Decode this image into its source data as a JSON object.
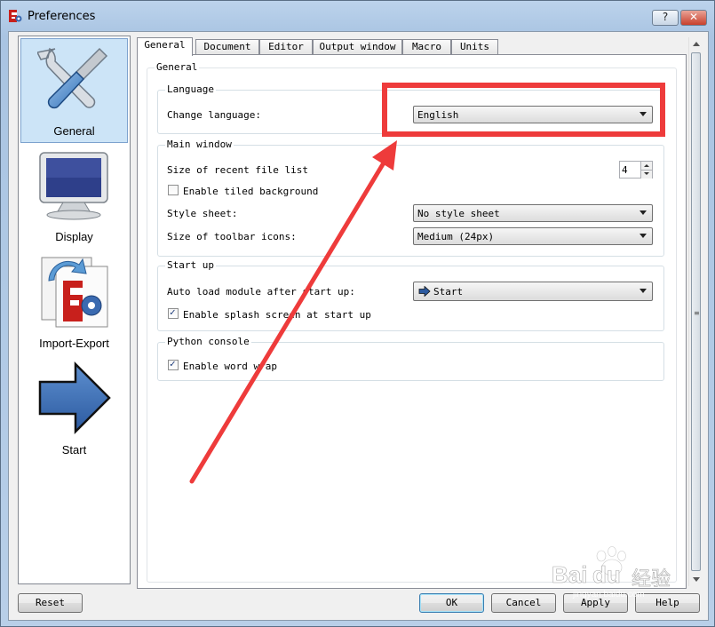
{
  "window": {
    "title": "Preferences",
    "help_button": "?",
    "close_button": "✕"
  },
  "sidebar": {
    "items": [
      {
        "label": "General",
        "icon": "wrench-screwdriver-icon",
        "selected": true
      },
      {
        "label": "Display",
        "icon": "monitor-icon",
        "selected": false
      },
      {
        "label": "Import-Export",
        "icon": "import-export-icon",
        "selected": false
      },
      {
        "label": "Start",
        "icon": "arrow-right-icon",
        "selected": false
      }
    ]
  },
  "tabs": [
    "General",
    "Document",
    "Editor",
    "Output window",
    "Macro",
    "Units"
  ],
  "active_tab": "General",
  "page": {
    "outer_group": "General",
    "language": {
      "title": "Language",
      "change_label": "Change language:",
      "value": "English"
    },
    "main_window": {
      "title": "Main window",
      "recent_label": "Size of recent file list",
      "recent_value": "4",
      "tiled_label": "Enable tiled background",
      "tiled_checked": false,
      "style_label": "Style sheet:",
      "style_value": "No style sheet",
      "toolbar_label": "Size of toolbar icons:",
      "toolbar_value": "Medium (24px)"
    },
    "start_up": {
      "title": "Start up",
      "autoload_label": "Auto load module after start up:",
      "autoload_value": "Start",
      "splash_label": "Enable splash screen at start up",
      "splash_checked": true
    },
    "python_console": {
      "title": "Python console",
      "wrap_label": "Enable word wrap",
      "wrap_checked": true
    }
  },
  "buttons": {
    "reset": "Reset",
    "ok": "OK",
    "cancel": "Cancel",
    "apply": "Apply",
    "help": "Help"
  },
  "colors": {
    "annotation": "#ee3b3b",
    "selection": "#cce4f7"
  },
  "watermark": {
    "brand": "Bai",
    "brand2": "du",
    "chinese": "经验",
    "url": "jingyan.baidu.com"
  }
}
